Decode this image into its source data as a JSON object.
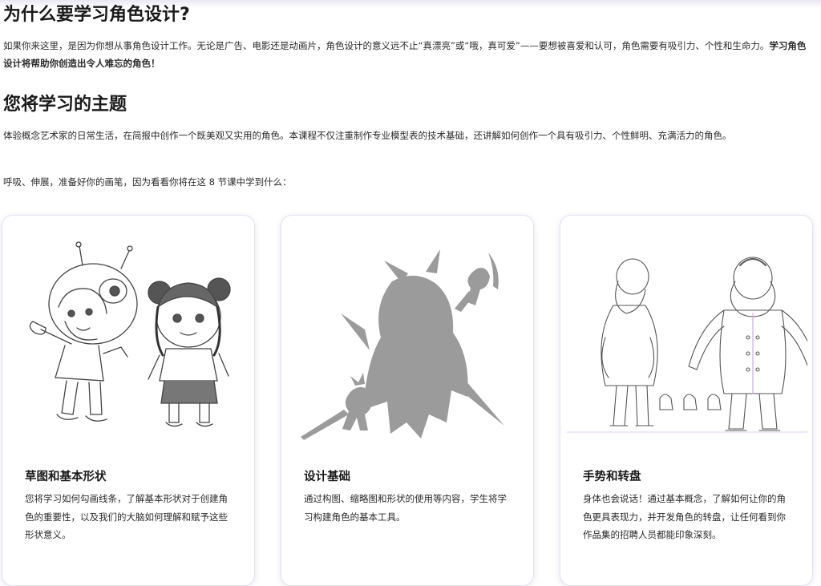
{
  "why": {
    "title": "为什么要学习角色设计?",
    "paragraph": "如果你来这里，是因为你想从事角色设计工作。无论是广告、电影还是动画片，角色设计的意义远不止“真漂亮”或“哦，真可爱”——要想被喜爱和认可，角色需要有吸引力、个性和生命力。",
    "paragraph_bold": "学习角色设计将帮助你创造出令人难忘的角色！"
  },
  "topics": {
    "title": "您将学习的主题",
    "paragraph": "体验概念艺术家的日常生活，在简报中创作一个既美观又实用的角色。本课程不仅注重制作专业模型表的技术基础，还讲解如何创作一个具有吸引力、个性鲜明、充满活力的角色。",
    "intro": "呼吸、伸展，准备好你的画笔，因为看看你将在这 8 节课中学到什么："
  },
  "cards": [
    {
      "title": "草图和基本形状",
      "desc": "您将学习如何勾画线条，了解基本形状对于创建角色的重要性，以及我们的大脑如何理解和赋予这些形状意义。"
    },
    {
      "title": "设计基础",
      "desc": "通过构图、缩略图和形状的使用等内容，学生将学习构建角色的基本工具。"
    },
    {
      "title": "手势和转盘",
      "desc": "身体也会说话！通过基本概念，了解如何让你的角色更具表现力，并开发角色的转盘，让任何看到你作品集的招聘人员都能印象深刻。"
    }
  ],
  "colors": {
    "text": "#1f1f1f",
    "card_border": "#e4e1ee",
    "silhouette": "#9b9b9b",
    "sketch_line": "#444444"
  }
}
